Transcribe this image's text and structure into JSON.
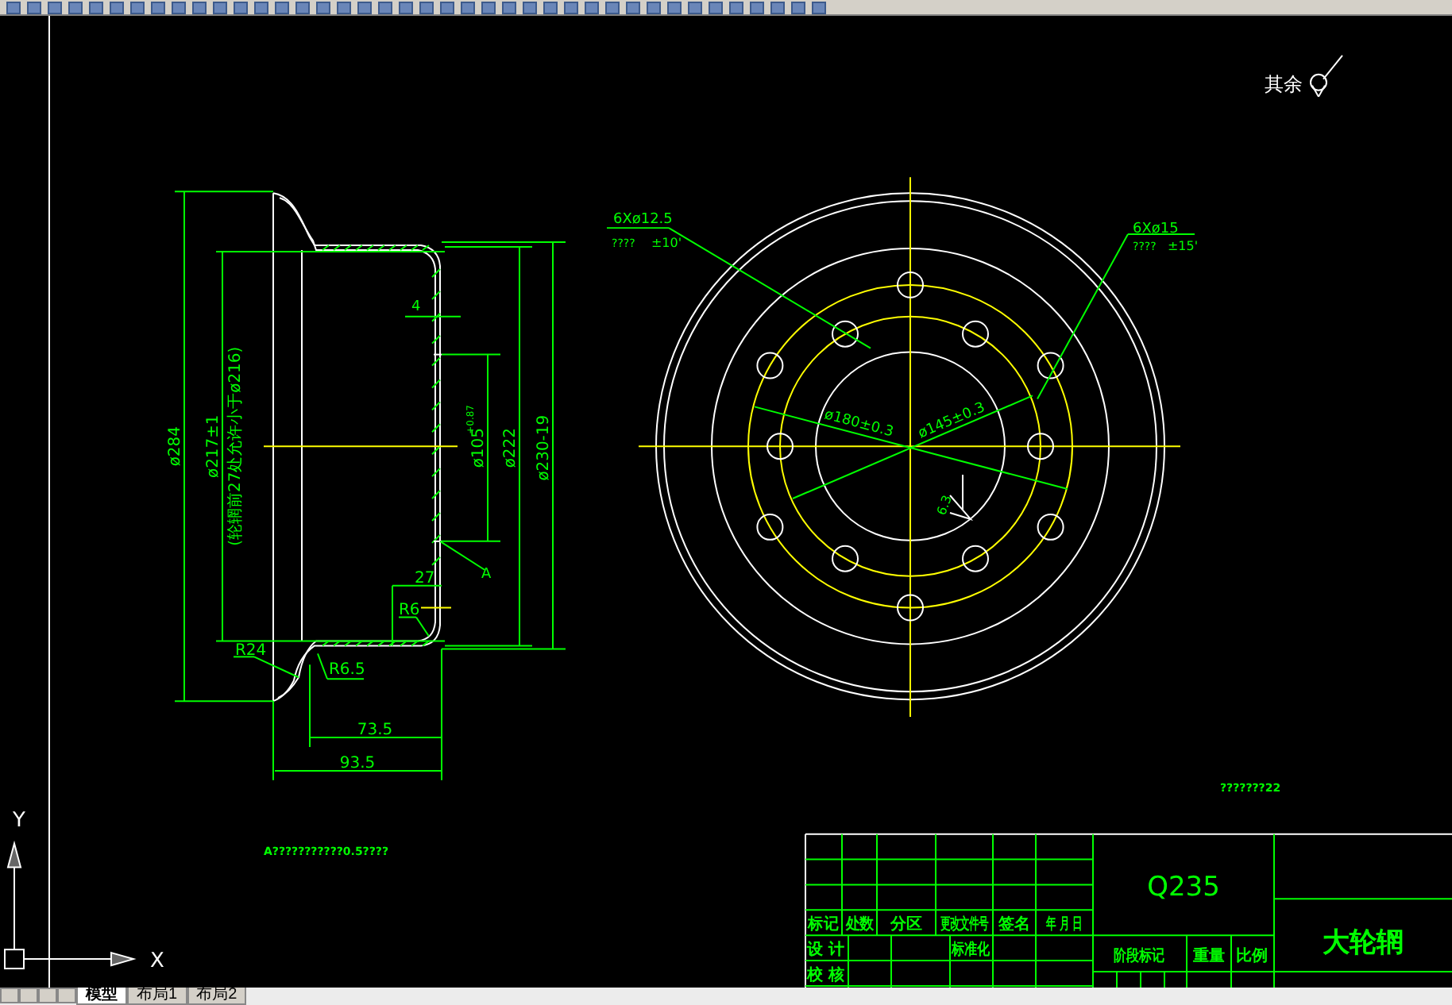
{
  "roughness_note": {
    "label": "其余"
  },
  "section_view": {
    "labels": [
      "ø284",
      "ø217±1",
      "(轮辋前27处允许小于ø216)",
      "4",
      "ø105",
      "+0.87",
      "ø222",
      "ø230-19",
      "A",
      "27",
      "R6",
      "R24",
      "R6.5",
      "73.5",
      "93.5"
    ]
  },
  "plan_view": {
    "labels": [
      "6Xø12.5",
      "????",
      "±10'",
      "6Xø15",
      "????",
      "±15'",
      "ø180±0.3",
      "ø145±0.3",
      "6.3"
    ]
  },
  "notes": [
    "A???????????0.5????",
    "???????22"
  ],
  "title_block": {
    "header_labels": [
      "标记",
      "处数",
      "分区",
      "更改文件号",
      "签名",
      "年 月 日"
    ],
    "row_labels": [
      "设 计",
      "标准化",
      "校 核"
    ],
    "material": "Q235",
    "stage_labels": [
      "阶段标记",
      "重量",
      "比例"
    ],
    "part_name": "大轮辋"
  },
  "ucs": {
    "y_label": "Y",
    "x_label": "X"
  },
  "layout_tabs": [
    {
      "label": "模型",
      "selected": true
    },
    {
      "label": "布局1",
      "selected": false
    },
    {
      "label": "布局2",
      "selected": false
    }
  ]
}
